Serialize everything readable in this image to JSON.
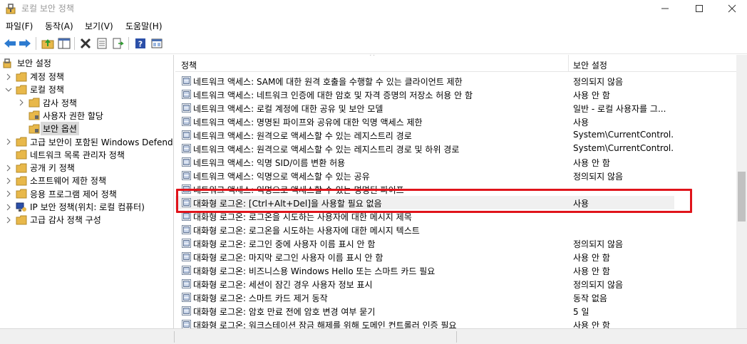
{
  "window": {
    "title": "로컬 보안 정책"
  },
  "menu": [
    {
      "label": "파일(F)"
    },
    {
      "label": "동작(A)"
    },
    {
      "label": "보기(V)"
    },
    {
      "label": "도움말(H)"
    }
  ],
  "toolbar": [
    {
      "icon": "back-arrow-icon"
    },
    {
      "icon": "forward-arrow-icon"
    },
    {
      "icon": "up-folder-icon"
    },
    {
      "icon": "show-hide-tree-icon"
    },
    {
      "icon": "delete-x-icon"
    },
    {
      "icon": "properties-icon"
    },
    {
      "icon": "export-list-icon"
    },
    {
      "icon": "help-icon"
    },
    {
      "icon": "console-view-icon"
    }
  ],
  "tree": {
    "root": "보안 설정",
    "items": [
      {
        "label": "계정 정책",
        "expander": "collapsed",
        "level": 1
      },
      {
        "label": "로컬 정책",
        "expander": "expanded",
        "level": 1
      },
      {
        "label": "감사 정책",
        "expander": "collapsed",
        "level": 2
      },
      {
        "label": "사용자 권한 할당",
        "expander": "none",
        "level": 2
      },
      {
        "label": "보안 옵션",
        "expander": "none",
        "level": 2,
        "selected": true
      },
      {
        "label": "고급 보안이 포함된 Windows Defender",
        "expander": "collapsed",
        "level": 1
      },
      {
        "label": "네트워크 목록 관리자 정책",
        "expander": "none",
        "level": 1
      },
      {
        "label": "공개 키 정책",
        "expander": "collapsed",
        "level": 1
      },
      {
        "label": "소프트웨어 제한 정책",
        "expander": "collapsed",
        "level": 1
      },
      {
        "label": "응용 프로그램 제어 정책",
        "expander": "collapsed",
        "level": 1
      },
      {
        "label": "IP 보안 정책(위치: 로컬 컴퓨터)",
        "expander": "collapsed",
        "level": 1
      },
      {
        "label": "고급 감사 정책 구성",
        "expander": "collapsed",
        "level": 1
      }
    ]
  },
  "list": {
    "columns": {
      "policy": "정책",
      "setting": "보안 설정"
    },
    "rows": [
      {
        "policy": "네트워크 액세스: SAM에 대한 원격 호출을 수행할 수 있는 클라이언트 제한",
        "setting": "정의되지 않음"
      },
      {
        "policy": "네트워크 액세스: 네트워크 인증에 대한 암호 및 자격 증명의 저장소 허용 안 함",
        "setting": "사용 안 함"
      },
      {
        "policy": "네트워크 액세스: 로컬 계정에 대한 공유 및 보안 모델",
        "setting": "일반 - 로컬 사용자를 그..."
      },
      {
        "policy": "네트워크 액세스: 명명된 파이프와 공유에 대한 익명 액세스 제한",
        "setting": "사용"
      },
      {
        "policy": "네트워크 액세스: 원격으로 액세스할 수 있는 레지스트리 경로",
        "setting": "System\\CurrentControl..."
      },
      {
        "policy": "네트워크 액세스: 원격으로 액세스할 수 있는 레지스트리 경로 및 하위 경로",
        "setting": "System\\CurrentControl..."
      },
      {
        "policy": "네트워크 액세스: 익명 SID/이름 변환 허용",
        "setting": "사용 안 함"
      },
      {
        "policy": "네트워크 액세스: 익명으로 액세스할 수 있는 공유",
        "setting": "정의되지 않음"
      },
      {
        "policy": "네트워크 액세스: 익명으로 액세스할 수 있는 명명된 파이프",
        "setting": ""
      },
      {
        "policy": "대화형 로그온: [Ctrl+Alt+Del]을 사용할 필요 없음",
        "setting": "사용",
        "highlighted": true
      },
      {
        "policy": "대화형 로그온: 로그온을 시도하는 사용자에 대한 메시지 제목",
        "setting": ""
      },
      {
        "policy": "대화형 로그온: 로그온을 시도하는 사용자에 대한 메시지 텍스트",
        "setting": ""
      },
      {
        "policy": "대화형 로그온: 로그인 중에 사용자 이름 표시 안 함",
        "setting": "정의되지 않음"
      },
      {
        "policy": "대화형 로그온: 마지막 로그인 사용자 이름 표시 안 함",
        "setting": "사용 안 함"
      },
      {
        "policy": "대화형 로그온: 비즈니스용 Windows Hello 또는 스마트 카드 필요",
        "setting": "사용 안 함"
      },
      {
        "policy": "대화형 로그온: 세션이 잠긴 경우 사용자 정보 표시",
        "setting": "정의되지 않음"
      },
      {
        "policy": "대화형 로그온: 스마트 카드 제거 동작",
        "setting": "동작 없음"
      },
      {
        "policy": "대화형 로그온: 암호 만료 전에 암호 변경 여부 묻기",
        "setting": "5 일"
      },
      {
        "policy": "대화형 로그온: 워크스테이션 잠금 해제를 위해 도메인 컨트롤러 인증 필요",
        "setting": "사용 안 함"
      }
    ]
  },
  "colors": {
    "highlight_box": "#e0141b",
    "folder": "#e8b84a",
    "selected_bg": "#d9d9d9"
  }
}
